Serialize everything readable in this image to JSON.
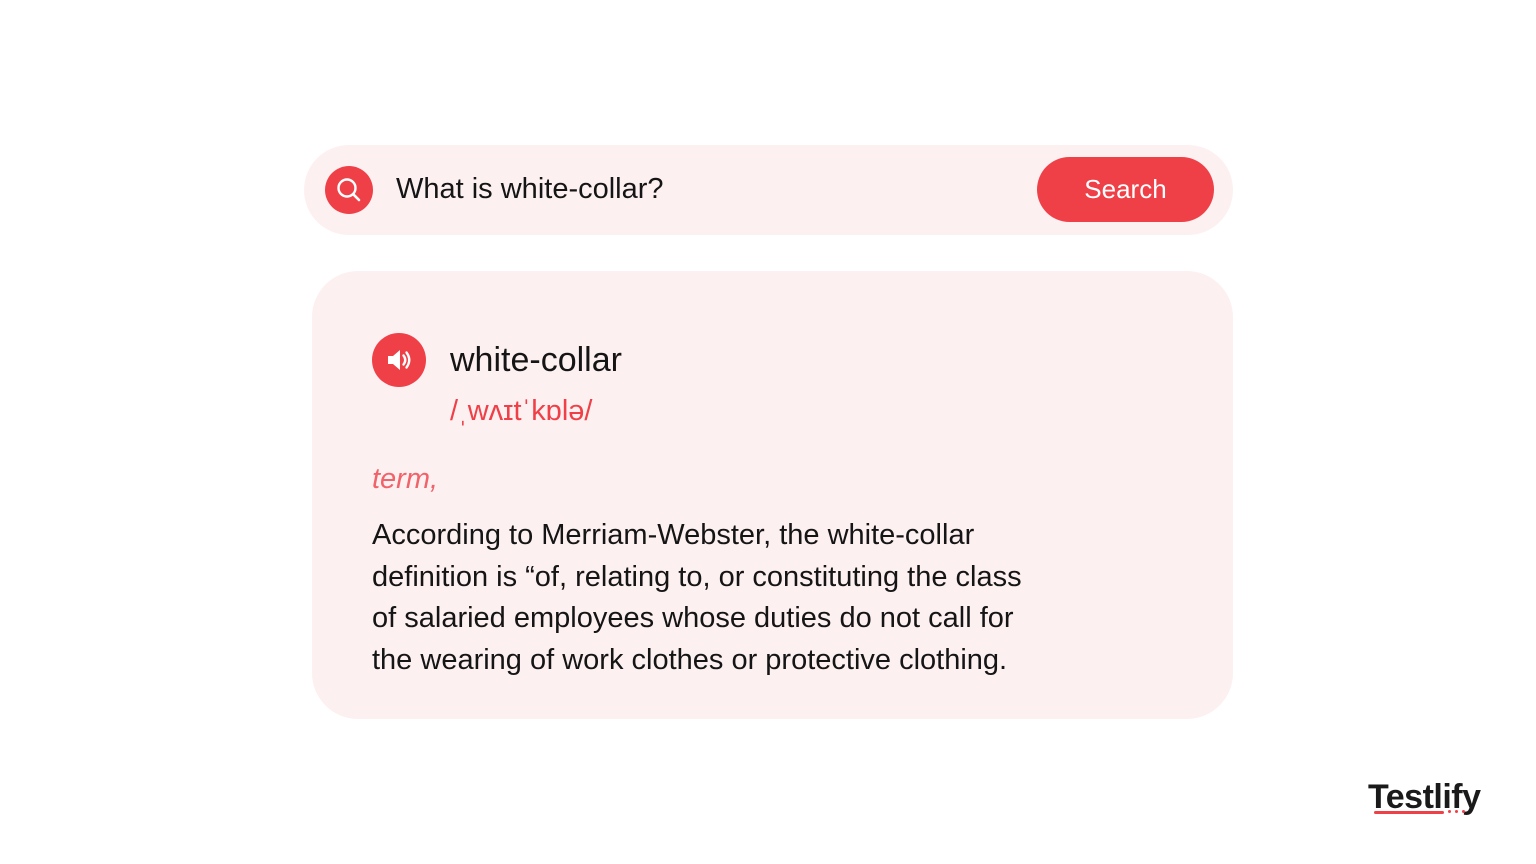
{
  "search": {
    "query": "What is white-collar?",
    "button_label": "Search",
    "icon": "search-icon"
  },
  "entry": {
    "word": "white-collar",
    "pronunciation": "/ˌwʌɪtˈkɒlə/",
    "part_of_speech": "term,",
    "audio_icon": "speaker-icon",
    "definition_lines": [
      "According to Merriam-Webster, the white-collar",
      "definition is “of, relating to, or constituting the class",
      "of salaried employees whose duties do not call for",
      "the wearing of work clothes or protective clothing."
    ]
  },
  "brand": {
    "logo_text": "Testlify"
  },
  "colors": {
    "accent": "#ef4048",
    "panel": "#fdf0f1",
    "text": "#151515",
    "part_of_speech": "#f0636a"
  }
}
